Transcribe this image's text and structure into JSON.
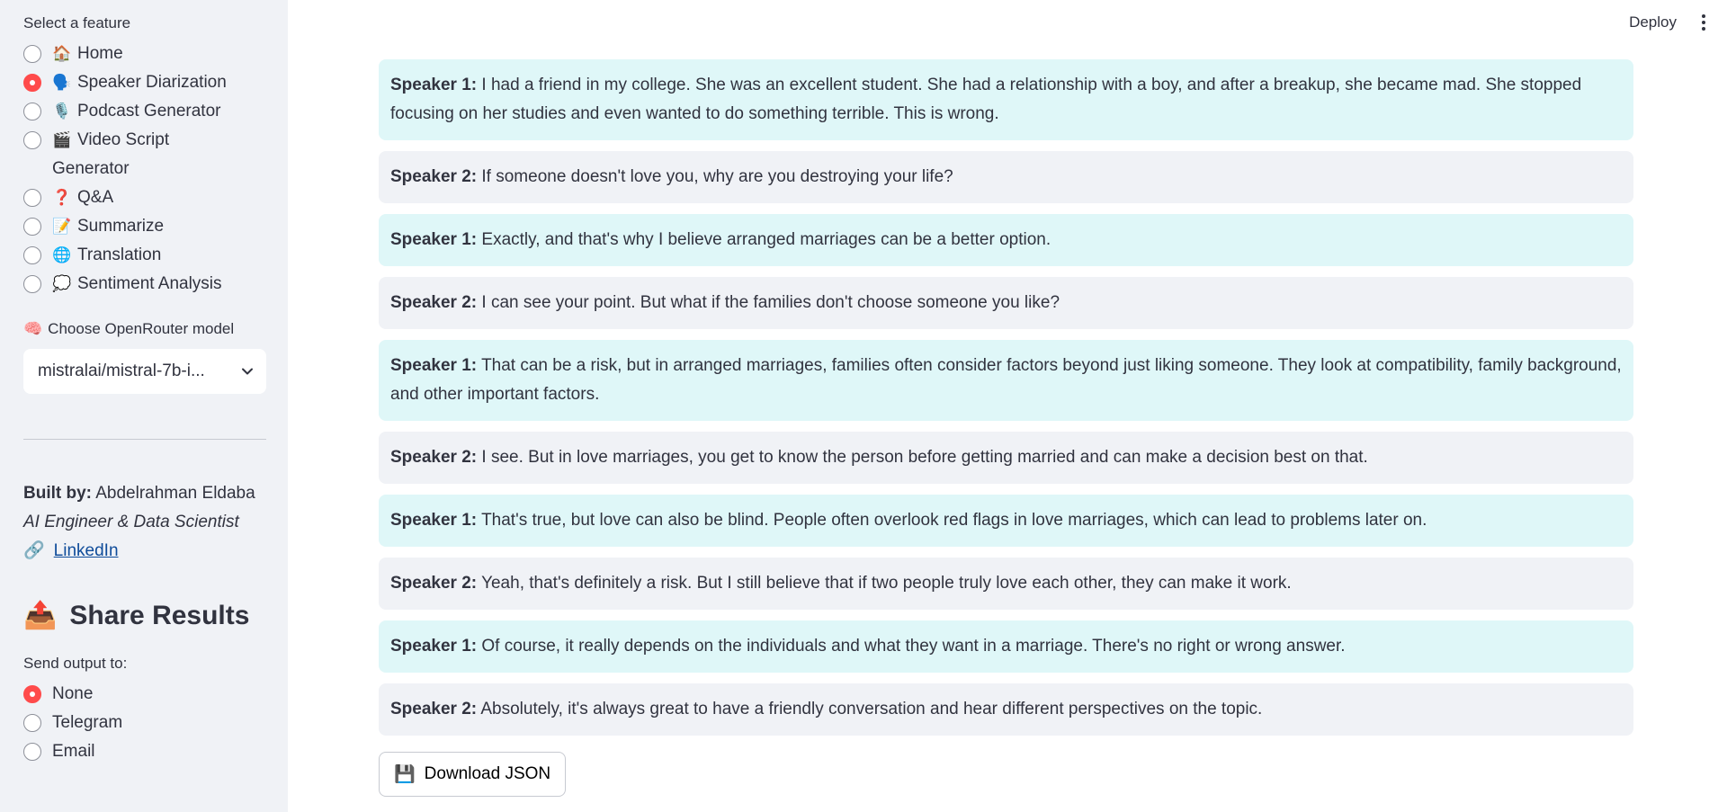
{
  "sidebar": {
    "feature_label": "Select a feature",
    "features": [
      {
        "icon": "🏠",
        "label": "Home",
        "checked": false
      },
      {
        "icon": "🗣️",
        "label": "Speaker Diarization",
        "checked": true
      },
      {
        "icon": "🎙️",
        "label": "Podcast Generator",
        "checked": false
      },
      {
        "icon": "🎬",
        "label": "Video Script Generator",
        "checked": false
      },
      {
        "icon": "❓",
        "label": "Q&A",
        "checked": false
      },
      {
        "icon": "📝",
        "label": "Summarize",
        "checked": false
      },
      {
        "icon": "🌐",
        "label": "Translation",
        "checked": false
      },
      {
        "icon": "💭",
        "label": "Sentiment Analysis",
        "checked": false
      }
    ],
    "model_icon": "🧠",
    "model_label": "Choose OpenRouter model",
    "model_value": "mistralai/mistral-7b-i...",
    "built_by_label": "Built by:",
    "built_by_name": "Abdelrahman Eldaba",
    "role": "AI Engineer & Data Scientist",
    "link_icon": "🔗",
    "link_label": "LinkedIn",
    "share_icon": "📤",
    "share_title": "Share Results",
    "send_label": "Send output to:",
    "send_options": [
      {
        "label": "None",
        "checked": true
      },
      {
        "label": "Telegram",
        "checked": false
      },
      {
        "label": "Email",
        "checked": false
      }
    ]
  },
  "topbar": {
    "deploy_label": "Deploy"
  },
  "conversation": [
    {
      "speaker": "Speaker 1:",
      "text": "I had a friend in my college. She was an excellent student. She had a relationship with a boy, and after a breakup, she became mad. She stopped focusing on her studies and even wanted to do something terrible. This is wrong."
    },
    {
      "speaker": "Speaker 2:",
      "text": "If someone doesn't love you, why are you destroying your life?"
    },
    {
      "speaker": "Speaker 1:",
      "text": "Exactly, and that's why I believe arranged marriages can be a better option."
    },
    {
      "speaker": "Speaker 2:",
      "text": "I can see your point. But what if the families don't choose someone you like?"
    },
    {
      "speaker": "Speaker 1:",
      "text": "That can be a risk, but in arranged marriages, families often consider factors beyond just liking someone. They look at compatibility, family background, and other important factors."
    },
    {
      "speaker": "Speaker 2:",
      "text": "I see. But in love marriages, you get to know the person before getting married and can make a decision best on that."
    },
    {
      "speaker": "Speaker 1:",
      "text": "That's true, but love can also be blind. People often overlook red flags in love marriages, which can lead to problems later on."
    },
    {
      "speaker": "Speaker 2:",
      "text": "Yeah, that's definitely a risk. But I still believe that if two people truly love each other, they can make it work."
    },
    {
      "speaker": "Speaker 1:",
      "text": "Of course, it really depends on the individuals and what they want in a marriage. There's no right or wrong answer."
    },
    {
      "speaker": "Speaker 2:",
      "text": "Absolutely, it's always great to have a friendly conversation and hear different perspectives on the topic."
    }
  ],
  "download": {
    "icon": "💾",
    "label": "Download JSON"
  }
}
